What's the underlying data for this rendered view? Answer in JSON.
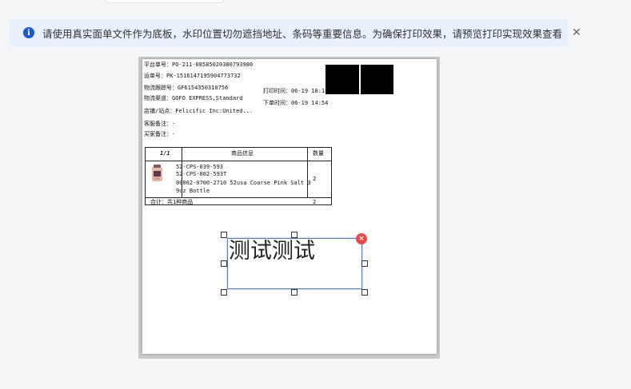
{
  "notice": {
    "text": "请使用真实面单文件作为底板，水印位置切勿遮挡地址、条码等重要信息。为确保打印效果，请预览打印实现效果查看",
    "close_glyph": "✕",
    "info_glyph": "i"
  },
  "label": {
    "platform_no": "平台单号：PO-211-08585020380793980",
    "waybill_no": "运单号：PK-1516147195904773732",
    "tracking_no": "物流跟踪号：GF6154350310756",
    "channel": "物流渠道：GOFO EXPRESS,Standard",
    "print_time": "打印时间：06-19 18:1",
    "order_time": "下单时间：06-19 14:54",
    "shop": "店铺/站点：Felicific Inc:United...",
    "service_note": "客服备注：-",
    "buyer_note": "买家备注：-",
    "table": {
      "page": "1/1",
      "col_product": "商品信息",
      "col_qty": "数量",
      "sku1": "52-CPS-039-593",
      "sku2": "52-CPS-002-593T",
      "desc1": "00002-0700-2710 52usa Coarse Pink Salt 3",
      "desc2": "9oz Bottle",
      "qty": "2",
      "total": "合计：共1种商品",
      "total_qty": "2"
    }
  },
  "watermark": {
    "text": "测试测试",
    "delete_glyph": "×"
  },
  "colors": {
    "accent": "#1a56db",
    "notice_bg": "#e8f0fe",
    "selection": "#4a7bdc",
    "delete": "#f04848"
  }
}
